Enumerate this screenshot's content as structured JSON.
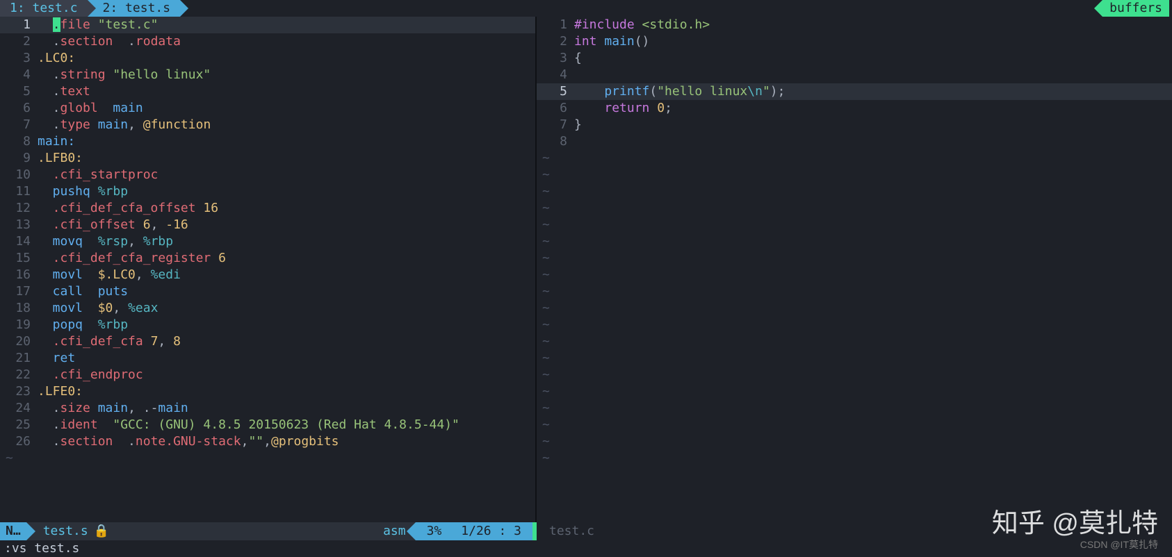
{
  "tabs": {
    "t1": "1: test.c",
    "t2": "2: test.s"
  },
  "buffers_label": "buffers",
  "left": {
    "lines": [
      {
        "n": "1",
        "active": true,
        "tokens": [
          [
            "  ",
            ""
          ],
          [
            ".",
            "cursor"
          ],
          [
            "file ",
            "tok-red"
          ],
          [
            "\"test.c\"",
            "tok-green"
          ]
        ]
      },
      {
        "n": "2",
        "tokens": [
          [
            "  .",
            ""
          ],
          [
            "section",
            "tok-red"
          ],
          [
            "  .",
            ""
          ],
          [
            "rodata",
            "tok-red"
          ]
        ]
      },
      {
        "n": "3",
        "tokens": [
          [
            ".LC0:",
            "tok-yellow"
          ]
        ]
      },
      {
        "n": "4",
        "tokens": [
          [
            "  .",
            ""
          ],
          [
            "string ",
            "tok-red"
          ],
          [
            "\"hello linux\"",
            "tok-green"
          ]
        ]
      },
      {
        "n": "5",
        "tokens": [
          [
            "  .",
            ""
          ],
          [
            "text",
            "tok-red"
          ]
        ]
      },
      {
        "n": "6",
        "tokens": [
          [
            "  .",
            ""
          ],
          [
            "globl",
            "tok-red"
          ],
          [
            "  main",
            "tok-blue"
          ]
        ]
      },
      {
        "n": "7",
        "tokens": [
          [
            "  .",
            ""
          ],
          [
            "type ",
            "tok-red"
          ],
          [
            "main",
            "tok-blue"
          ],
          [
            ", ",
            ""
          ],
          [
            "@function",
            "tok-yellow"
          ]
        ]
      },
      {
        "n": "8",
        "tokens": [
          [
            "main:",
            "tok-blue"
          ]
        ]
      },
      {
        "n": "9",
        "tokens": [
          [
            ".LFB0:",
            "tok-yellow"
          ]
        ]
      },
      {
        "n": "10",
        "tokens": [
          [
            "  .cfi_startproc",
            "tok-red"
          ]
        ]
      },
      {
        "n": "11",
        "tokens": [
          [
            "  pushq ",
            "tok-blue"
          ],
          [
            "%rbp",
            "tok-cyan"
          ]
        ]
      },
      {
        "n": "12",
        "tokens": [
          [
            "  .cfi_def_cfa_offset ",
            "tok-red"
          ],
          [
            "16",
            "tok-yellow"
          ]
        ]
      },
      {
        "n": "13",
        "tokens": [
          [
            "  .cfi_offset ",
            "tok-red"
          ],
          [
            "6",
            "tok-yellow"
          ],
          [
            ", ",
            ""
          ],
          [
            "-16",
            "tok-yellow"
          ]
        ]
      },
      {
        "n": "14",
        "tokens": [
          [
            "  movq  ",
            "tok-blue"
          ],
          [
            "%rsp",
            "tok-cyan"
          ],
          [
            ", ",
            ""
          ],
          [
            "%rbp",
            "tok-cyan"
          ]
        ]
      },
      {
        "n": "15",
        "tokens": [
          [
            "  .cfi_def_cfa_register ",
            "tok-red"
          ],
          [
            "6",
            "tok-yellow"
          ]
        ]
      },
      {
        "n": "16",
        "tokens": [
          [
            "  movl  ",
            "tok-blue"
          ],
          [
            "$.LC0",
            "tok-yellow"
          ],
          [
            ", ",
            ""
          ],
          [
            "%edi",
            "tok-cyan"
          ]
        ]
      },
      {
        "n": "17",
        "tokens": [
          [
            "  call  ",
            "tok-blue"
          ],
          [
            "puts",
            "tok-blue"
          ]
        ]
      },
      {
        "n": "18",
        "tokens": [
          [
            "  movl  ",
            "tok-blue"
          ],
          [
            "$0",
            "tok-yellow"
          ],
          [
            ", ",
            ""
          ],
          [
            "%eax",
            "tok-cyan"
          ]
        ]
      },
      {
        "n": "19",
        "tokens": [
          [
            "  popq  ",
            "tok-blue"
          ],
          [
            "%rbp",
            "tok-cyan"
          ]
        ]
      },
      {
        "n": "20",
        "tokens": [
          [
            "  .cfi_def_cfa ",
            "tok-red"
          ],
          [
            "7",
            "tok-yellow"
          ],
          [
            ", ",
            ""
          ],
          [
            "8",
            "tok-yellow"
          ]
        ]
      },
      {
        "n": "21",
        "tokens": [
          [
            "  ret",
            "tok-blue"
          ]
        ]
      },
      {
        "n": "22",
        "tokens": [
          [
            "  .cfi_endproc",
            "tok-red"
          ]
        ]
      },
      {
        "n": "23",
        "tokens": [
          [
            ".LFE0:",
            "tok-yellow"
          ]
        ]
      },
      {
        "n": "24",
        "tokens": [
          [
            "  .",
            ""
          ],
          [
            "size ",
            "tok-red"
          ],
          [
            "main",
            "tok-blue"
          ],
          [
            ", .-",
            ""
          ],
          [
            "main",
            "tok-blue"
          ]
        ]
      },
      {
        "n": "25",
        "tokens": [
          [
            "  .",
            ""
          ],
          [
            "ident  ",
            "tok-red"
          ],
          [
            "\"GCC: (GNU) 4.8.5 20150623 (Red Hat 4.8.5-44)\"",
            "tok-green"
          ]
        ]
      },
      {
        "n": "26",
        "tokens": [
          [
            "  .",
            ""
          ],
          [
            "section",
            "tok-red"
          ],
          [
            "  .",
            ""
          ],
          [
            "note.GNU-stack",
            "tok-red"
          ],
          [
            ",",
            ""
          ],
          [
            "\"\"",
            "tok-green"
          ],
          [
            ",",
            ""
          ],
          [
            "@progbits",
            "tok-yellow"
          ]
        ]
      }
    ],
    "tilde_count": 1
  },
  "right": {
    "lines": [
      {
        "n": "1",
        "tokens": [
          [
            "#include ",
            "tok-purple"
          ],
          [
            "<stdio.h>",
            "tok-green"
          ]
        ]
      },
      {
        "n": "2",
        "tokens": [
          [
            "int ",
            "tok-purple"
          ],
          [
            "main",
            "tok-blue"
          ],
          [
            "()",
            "tok-white"
          ]
        ]
      },
      {
        "n": "3",
        "tokens": [
          [
            "{",
            "tok-white"
          ]
        ]
      },
      {
        "n": "4",
        "tokens": [
          [
            "",
            ""
          ]
        ]
      },
      {
        "n": "5",
        "active": true,
        "tokens": [
          [
            "    printf",
            "tok-blue"
          ],
          [
            "(",
            "tok-white"
          ],
          [
            "\"hello linux",
            "tok-green"
          ],
          [
            "\\n",
            "tok-cyan"
          ],
          [
            "\"",
            "tok-green"
          ],
          [
            ");",
            "tok-white"
          ]
        ]
      },
      {
        "n": "6",
        "tokens": [
          [
            "    ",
            "tok-white"
          ],
          [
            "return ",
            "tok-purple"
          ],
          [
            "0",
            "tok-yellow"
          ],
          [
            ";",
            "tok-white"
          ]
        ]
      },
      {
        "n": "7",
        "tokens": [
          [
            "}",
            "tok-white"
          ]
        ]
      },
      {
        "n": "8",
        "tokens": [
          [
            "",
            ""
          ]
        ]
      }
    ],
    "tilde_count": 19
  },
  "status": {
    "mode": "N…",
    "file_left": "test.s",
    "lock": "🔒",
    "filetype": "asm",
    "percent": "3%",
    "position": "1/26 :   3",
    "file_right": "test.c"
  },
  "cmdline": ":vs test.s",
  "watermark": "知乎 @莫扎特",
  "credit": "CSDN @IT莫扎特"
}
